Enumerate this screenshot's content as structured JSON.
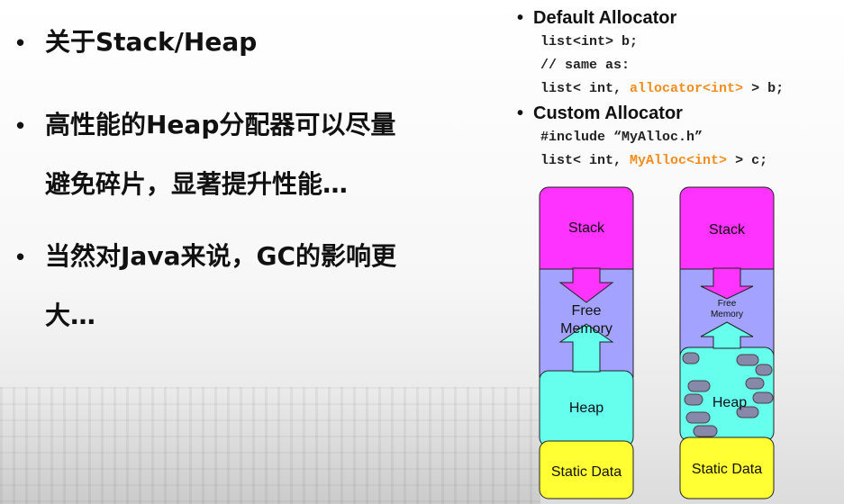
{
  "bullets": [
    "关于Stack/Heap",
    "高性能的Heap分配器可以尽量避免碎片，显著提升性能…",
    "当然对Java来说，GC的影响更大…"
  ],
  "bullet_lines": {
    "b2_line1": "高性能的Heap分配器可以尽量",
    "b2_line2": "避免碎片，显著提升性能…",
    "b3_line1": "当然对Java来说，GC的影响更",
    "b3_line2": "大…"
  },
  "code": {
    "default_heading": "Default Allocator",
    "default_line1": "list<int> b;",
    "default_comment": "// same as:",
    "default_line3_a": "list< int, ",
    "default_line3_hl": "allocator<int>",
    "default_line3_b": " > b;",
    "custom_heading": "Custom Allocator",
    "custom_line1": "#include “MyAlloc.h”",
    "custom_line2_a": "list< int, ",
    "custom_line2_hl": "MyAlloc<int>",
    "custom_line2_b": " > c;"
  },
  "diagram": {
    "left": {
      "stack": "Stack",
      "free_line1": "Free",
      "free_line2": "Memory",
      "heap": "Heap",
      "static": "Static Data"
    },
    "right": {
      "stack": "Stack",
      "free_line1": "Free",
      "free_line2": "Memory",
      "heap": "Heap",
      "static": "Static Data"
    },
    "colors": {
      "stack": "#ff33ff",
      "free": "#a3a3ff",
      "heap": "#66ffee",
      "static": "#ffff33",
      "fragment": "#8888aa"
    }
  }
}
